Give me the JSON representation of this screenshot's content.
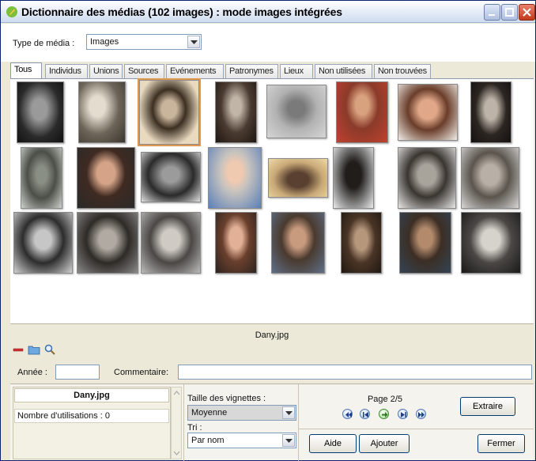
{
  "window": {
    "title": "Dictionnaire des médias (102 images) : mode images intégrées"
  },
  "media_type": {
    "label": "Type de média :",
    "value": "Images"
  },
  "tabs": [
    {
      "label": "Tous",
      "active": true
    },
    {
      "label": "Individus"
    },
    {
      "label": "Unions"
    },
    {
      "label": "Sources"
    },
    {
      "label": "Evénements"
    },
    {
      "label": "Patronymes"
    },
    {
      "label": "Lieux"
    },
    {
      "label": "Non utilisées"
    },
    {
      "label": "Non trouvées"
    }
  ],
  "current_file": "Dany.jpg",
  "fields": {
    "year_label": "Année :",
    "year_value": "",
    "comment_label": "Commentaire:",
    "comment_value": ""
  },
  "info_panel": {
    "title": "Dany.jpg",
    "usage": "Nombre d'utilisations : 0"
  },
  "thumb_size": {
    "label": "Taille des vignettes :",
    "value": "Moyenne"
  },
  "sort": {
    "label": "Tri :",
    "value": "Par nom"
  },
  "pagination": {
    "label": "Page 2/5"
  },
  "buttons": {
    "extract": "Extraire",
    "help": "Aide",
    "add": "Ajouter",
    "close": "Fermer"
  },
  "icons": [
    "app-icon",
    "minimize-icon",
    "maximize-icon",
    "close-icon",
    "remove-icon",
    "folder-icon",
    "search-icon",
    "first-page-icon",
    "prev-page-icon",
    "goto-icon",
    "next-page-icon",
    "last-page-icon"
  ],
  "colors": {
    "title_bar": "#cfdcef",
    "selected_outline": "#e0994c",
    "window_bg": "#ece9d8"
  }
}
